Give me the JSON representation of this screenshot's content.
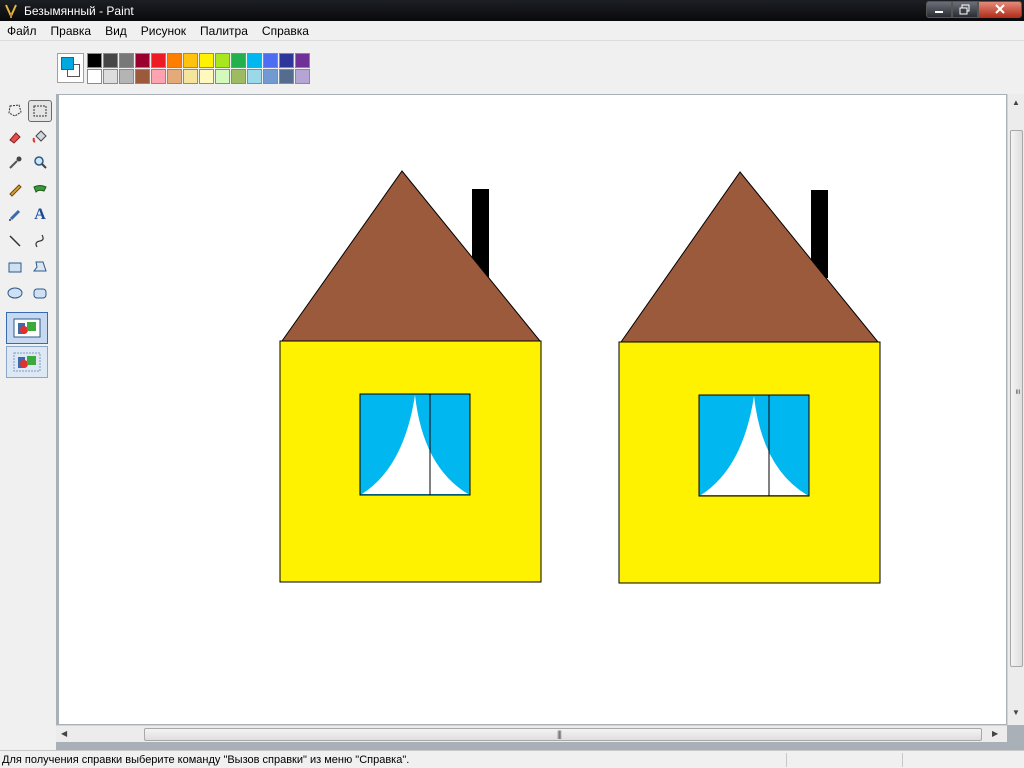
{
  "window": {
    "title": "Безымянный - Paint"
  },
  "menu": {
    "items": [
      {
        "label": "Файл"
      },
      {
        "label": "Правка"
      },
      {
        "label": "Вид"
      },
      {
        "label": "Рисунок"
      },
      {
        "label": "Палитра"
      },
      {
        "label": "Справка"
      }
    ]
  },
  "palette": {
    "foreground": "#00a8e0",
    "background": "#ffffff",
    "colors": [
      "#000000",
      "#464646",
      "#787878",
      "#990030",
      "#ed1c24",
      "#ff7e00",
      "#ffc20e",
      "#fff200",
      "#a8e61d",
      "#22b14c",
      "#00b7ef",
      "#4d6df3",
      "#2f3699",
      "#6f3198",
      "#ffffff",
      "#dcdcdc",
      "#b4b4b4",
      "#9c5a3c",
      "#ffa3b1",
      "#e5aa7a",
      "#f5e49c",
      "#fff9bd",
      "#d3f9bc",
      "#9dbb61",
      "#99d9ea",
      "#709ad1",
      "#546d8e",
      "#b5a5d5"
    ]
  },
  "tools": [
    {
      "name": "free-select-icon"
    },
    {
      "name": "rect-select-icon"
    },
    {
      "name": "eraser-icon"
    },
    {
      "name": "fill-icon"
    },
    {
      "name": "color-picker-icon"
    },
    {
      "name": "magnifier-icon"
    },
    {
      "name": "pencil-icon"
    },
    {
      "name": "brush-icon"
    },
    {
      "name": "airbrush-icon"
    },
    {
      "name": "text-icon",
      "glyph": "A"
    },
    {
      "name": "line-icon"
    },
    {
      "name": "curve-icon"
    },
    {
      "name": "rectangle-icon"
    },
    {
      "name": "polygon-icon"
    },
    {
      "name": "ellipse-icon"
    },
    {
      "name": "rounded-rect-icon"
    }
  ],
  "drawing": {
    "roof_color": "#9c5a3c",
    "wall_color": "#fff200",
    "window_color": "#00b7ef",
    "curtain_color": "#ffffff",
    "chimney_color": "#000000"
  },
  "status": {
    "text": "Для получения справки выберите команду \"Вызов справки\" из меню \"Справка\"."
  }
}
